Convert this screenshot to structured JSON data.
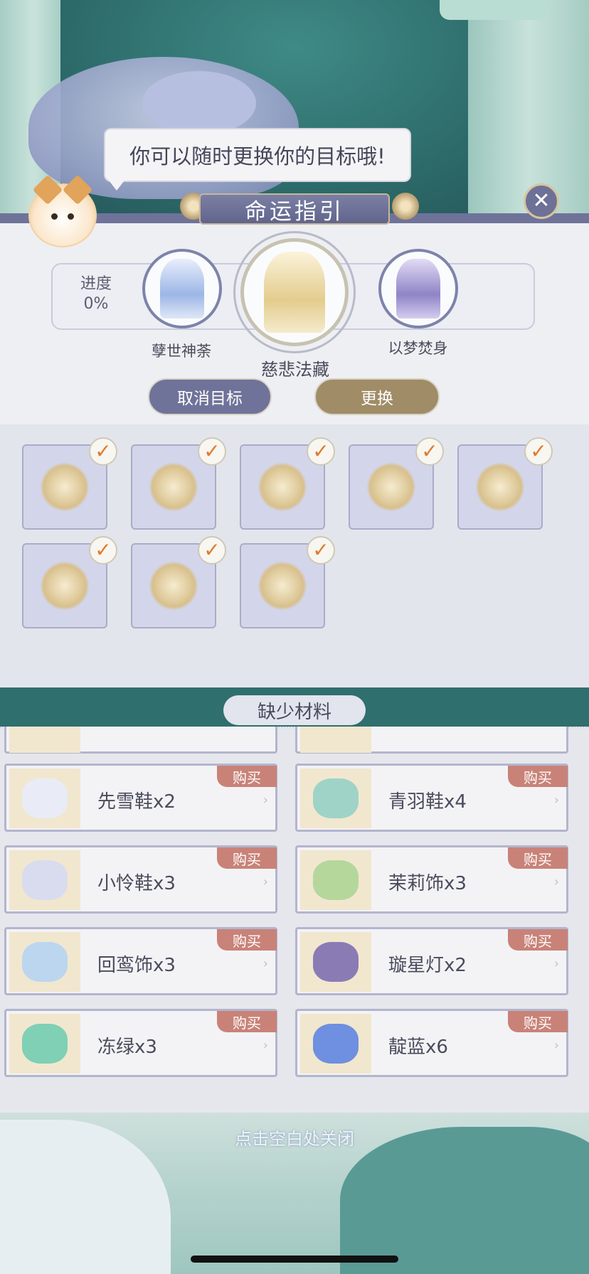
{
  "bubble_text": "你可以随时更换你的目标哦!",
  "title": "命运指引",
  "close_icon": "✕",
  "progress": {
    "label": "进度",
    "value": "0%"
  },
  "outfits": {
    "left": "孽世神荼",
    "main": "慈悲法藏",
    "right": "以梦焚身"
  },
  "buttons": {
    "cancel": "取消目标",
    "change": "更换"
  },
  "owned_items_check": "✓",
  "missing_title": "缺少材料",
  "materials": {
    "buy_label": "购买",
    "arrow": "›",
    "items": [
      {
        "name": "先雪鞋x2"
      },
      {
        "name": "青羽鞋x4"
      },
      {
        "name": "小怜鞋x3"
      },
      {
        "name": "茉莉饰x3"
      },
      {
        "name": "回鸾饰x3"
      },
      {
        "name": "璇星灯x2"
      },
      {
        "name": "冻绿x3"
      },
      {
        "name": "靛蓝x6"
      }
    ]
  },
  "close_hint": "点击空白处关闭",
  "colors": {
    "accent_purple": "#6f7399",
    "accent_gold": "#a08c66",
    "buy_red": "#c98278",
    "check_orange": "#e07a2c"
  }
}
